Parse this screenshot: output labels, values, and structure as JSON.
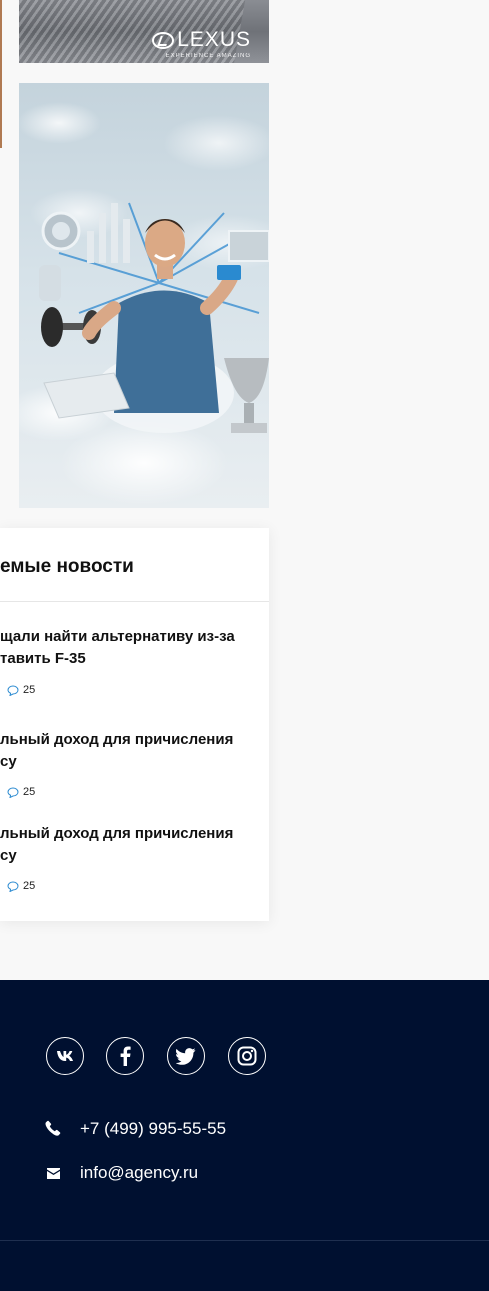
{
  "banners": {
    "lexus": {
      "brand": "LEXUS",
      "tagline": "EXPERIENCE AMAZING"
    }
  },
  "news": {
    "title": "емые новости",
    "items": [
      {
        "title": "щали найти альтернативу из-за\nтавить F-35",
        "comments": "25"
      },
      {
        "title": "льный доход для причисления\nсу",
        "comments": "25"
      },
      {
        "title": "льный доход для причисления\nсу",
        "comments": "25"
      }
    ]
  },
  "footer": {
    "social": [
      {
        "icon": "vk-icon"
      },
      {
        "icon": "facebook-icon"
      },
      {
        "icon": "twitter-icon"
      },
      {
        "icon": "instagram-icon"
      }
    ],
    "phone": "+7 (499) 995-55-55",
    "email": "info@agency.ru"
  },
  "colors": {
    "footer_bg": "#001030",
    "accent_blue": "#2a8ad0"
  }
}
